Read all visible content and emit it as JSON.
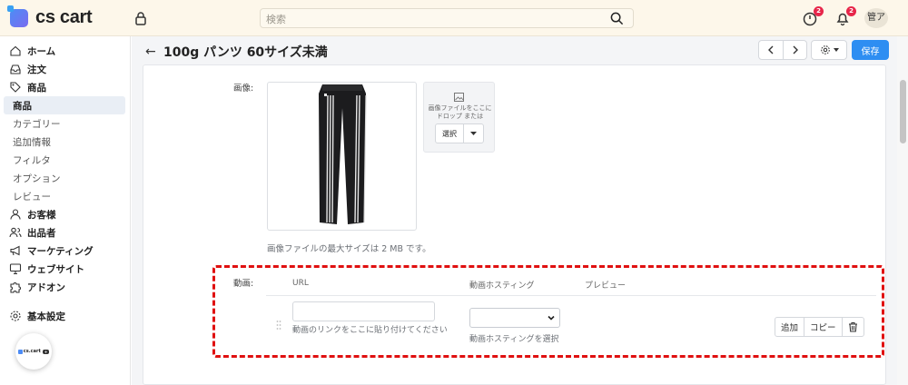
{
  "brand": {
    "name": "cs cart"
  },
  "search": {
    "placeholder": "検索"
  },
  "header": {
    "notif_count_1": "2",
    "notif_count_2": "2",
    "avatar": "管ア"
  },
  "sidebar": {
    "items": [
      {
        "label": "ホーム",
        "icon": "home-icon"
      },
      {
        "label": "注文",
        "icon": "inbox-icon"
      },
      {
        "label": "商品",
        "icon": "tag-icon"
      },
      {
        "label": "商品"
      },
      {
        "label": "カテゴリー"
      },
      {
        "label": "追加情報"
      },
      {
        "label": "フィルタ"
      },
      {
        "label": "オプション"
      },
      {
        "label": "レビュー"
      },
      {
        "label": "お客様",
        "icon": "user-icon"
      },
      {
        "label": "出品者",
        "icon": "users-icon"
      },
      {
        "label": "マーケティング",
        "icon": "megaphone-icon"
      },
      {
        "label": "ウェブサイト",
        "icon": "monitor-icon"
      },
      {
        "label": "アドオン",
        "icon": "puzzle-icon"
      },
      {
        "label": "基本設定",
        "icon": "gear-icon"
      }
    ]
  },
  "page": {
    "back": "←",
    "title": "100g パンツ 60サイズ未満",
    "save": "保存"
  },
  "form": {
    "image_label": "画像:",
    "drop_text": "画像ファイルをここにドロップ または",
    "select_label": "選択",
    "image_hint": "画像ファイルの最大サイズは 2 MB です。",
    "video_label": "動画:",
    "col_url": "URL",
    "col_hosting": "動画ホスティング",
    "col_preview": "プレビュー",
    "url_help": "動画のリンクをここに貼り付けてください",
    "host_help": "動画ホスティングを選択",
    "add": "追加",
    "copy": "コピー"
  },
  "colors": {
    "accent": "#2e8ef2",
    "highlight": "#e01010",
    "badge": "#e7264a",
    "topbar": "#fdf7ea"
  }
}
